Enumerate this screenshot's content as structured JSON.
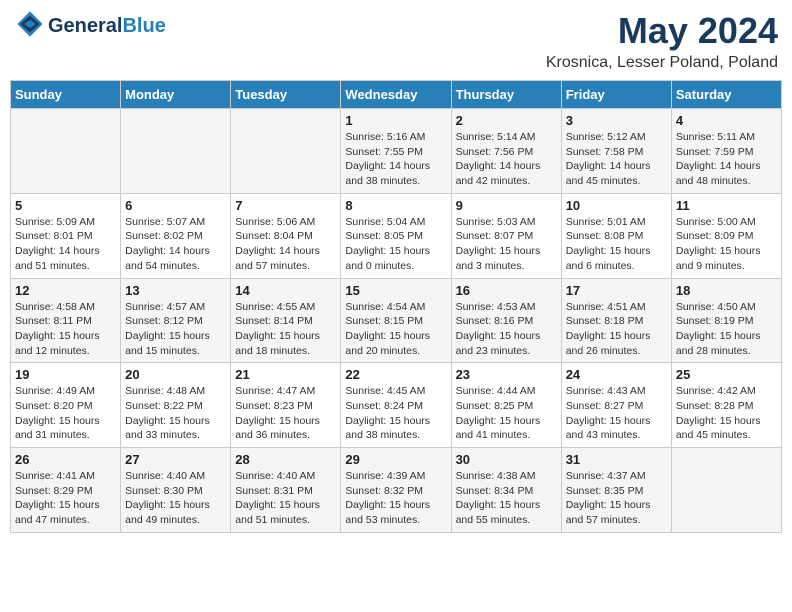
{
  "header": {
    "logo_general": "General",
    "logo_blue": "Blue",
    "month_title": "May 2024",
    "location": "Krosnica, Lesser Poland, Poland"
  },
  "days_of_week": [
    "Sunday",
    "Monday",
    "Tuesday",
    "Wednesday",
    "Thursday",
    "Friday",
    "Saturday"
  ],
  "weeks": [
    [
      {
        "day": "",
        "info": ""
      },
      {
        "day": "",
        "info": ""
      },
      {
        "day": "",
        "info": ""
      },
      {
        "day": "1",
        "info": "Sunrise: 5:16 AM\nSunset: 7:55 PM\nDaylight: 14 hours\nand 38 minutes."
      },
      {
        "day": "2",
        "info": "Sunrise: 5:14 AM\nSunset: 7:56 PM\nDaylight: 14 hours\nand 42 minutes."
      },
      {
        "day": "3",
        "info": "Sunrise: 5:12 AM\nSunset: 7:58 PM\nDaylight: 14 hours\nand 45 minutes."
      },
      {
        "day": "4",
        "info": "Sunrise: 5:11 AM\nSunset: 7:59 PM\nDaylight: 14 hours\nand 48 minutes."
      }
    ],
    [
      {
        "day": "5",
        "info": "Sunrise: 5:09 AM\nSunset: 8:01 PM\nDaylight: 14 hours\nand 51 minutes."
      },
      {
        "day": "6",
        "info": "Sunrise: 5:07 AM\nSunset: 8:02 PM\nDaylight: 14 hours\nand 54 minutes."
      },
      {
        "day": "7",
        "info": "Sunrise: 5:06 AM\nSunset: 8:04 PM\nDaylight: 14 hours\nand 57 minutes."
      },
      {
        "day": "8",
        "info": "Sunrise: 5:04 AM\nSunset: 8:05 PM\nDaylight: 15 hours\nand 0 minutes."
      },
      {
        "day": "9",
        "info": "Sunrise: 5:03 AM\nSunset: 8:07 PM\nDaylight: 15 hours\nand 3 minutes."
      },
      {
        "day": "10",
        "info": "Sunrise: 5:01 AM\nSunset: 8:08 PM\nDaylight: 15 hours\nand 6 minutes."
      },
      {
        "day": "11",
        "info": "Sunrise: 5:00 AM\nSunset: 8:09 PM\nDaylight: 15 hours\nand 9 minutes."
      }
    ],
    [
      {
        "day": "12",
        "info": "Sunrise: 4:58 AM\nSunset: 8:11 PM\nDaylight: 15 hours\nand 12 minutes."
      },
      {
        "day": "13",
        "info": "Sunrise: 4:57 AM\nSunset: 8:12 PM\nDaylight: 15 hours\nand 15 minutes."
      },
      {
        "day": "14",
        "info": "Sunrise: 4:55 AM\nSunset: 8:14 PM\nDaylight: 15 hours\nand 18 minutes."
      },
      {
        "day": "15",
        "info": "Sunrise: 4:54 AM\nSunset: 8:15 PM\nDaylight: 15 hours\nand 20 minutes."
      },
      {
        "day": "16",
        "info": "Sunrise: 4:53 AM\nSunset: 8:16 PM\nDaylight: 15 hours\nand 23 minutes."
      },
      {
        "day": "17",
        "info": "Sunrise: 4:51 AM\nSunset: 8:18 PM\nDaylight: 15 hours\nand 26 minutes."
      },
      {
        "day": "18",
        "info": "Sunrise: 4:50 AM\nSunset: 8:19 PM\nDaylight: 15 hours\nand 28 minutes."
      }
    ],
    [
      {
        "day": "19",
        "info": "Sunrise: 4:49 AM\nSunset: 8:20 PM\nDaylight: 15 hours\nand 31 minutes."
      },
      {
        "day": "20",
        "info": "Sunrise: 4:48 AM\nSunset: 8:22 PM\nDaylight: 15 hours\nand 33 minutes."
      },
      {
        "day": "21",
        "info": "Sunrise: 4:47 AM\nSunset: 8:23 PM\nDaylight: 15 hours\nand 36 minutes."
      },
      {
        "day": "22",
        "info": "Sunrise: 4:45 AM\nSunset: 8:24 PM\nDaylight: 15 hours\nand 38 minutes."
      },
      {
        "day": "23",
        "info": "Sunrise: 4:44 AM\nSunset: 8:25 PM\nDaylight: 15 hours\nand 41 minutes."
      },
      {
        "day": "24",
        "info": "Sunrise: 4:43 AM\nSunset: 8:27 PM\nDaylight: 15 hours\nand 43 minutes."
      },
      {
        "day": "25",
        "info": "Sunrise: 4:42 AM\nSunset: 8:28 PM\nDaylight: 15 hours\nand 45 minutes."
      }
    ],
    [
      {
        "day": "26",
        "info": "Sunrise: 4:41 AM\nSunset: 8:29 PM\nDaylight: 15 hours\nand 47 minutes."
      },
      {
        "day": "27",
        "info": "Sunrise: 4:40 AM\nSunset: 8:30 PM\nDaylight: 15 hours\nand 49 minutes."
      },
      {
        "day": "28",
        "info": "Sunrise: 4:40 AM\nSunset: 8:31 PM\nDaylight: 15 hours\nand 51 minutes."
      },
      {
        "day": "29",
        "info": "Sunrise: 4:39 AM\nSunset: 8:32 PM\nDaylight: 15 hours\nand 53 minutes."
      },
      {
        "day": "30",
        "info": "Sunrise: 4:38 AM\nSunset: 8:34 PM\nDaylight: 15 hours\nand 55 minutes."
      },
      {
        "day": "31",
        "info": "Sunrise: 4:37 AM\nSunset: 8:35 PM\nDaylight: 15 hours\nand 57 minutes."
      },
      {
        "day": "",
        "info": ""
      }
    ]
  ]
}
